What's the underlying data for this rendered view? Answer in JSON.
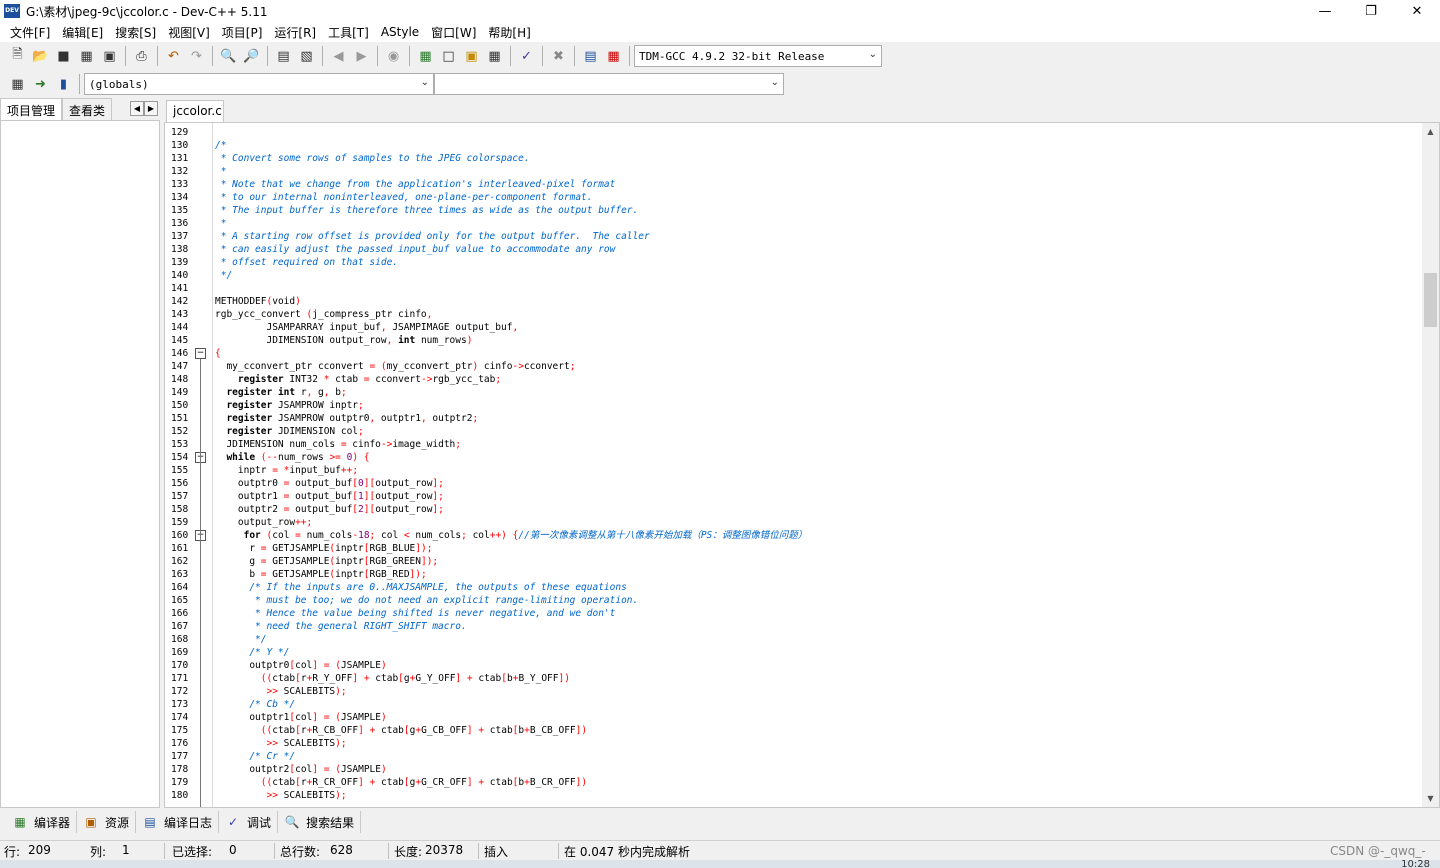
{
  "window": {
    "title": "G:\\素材\\jpeg-9c\\jccolor.c - Dev-C++ 5.11",
    "icon_text": "DEV"
  },
  "menu": [
    "文件[F]",
    "编辑[E]",
    "搜索[S]",
    "视图[V]",
    "项目[P]",
    "运行[R]",
    "工具[T]",
    "AStyle",
    "窗口[W]",
    "帮助[H]"
  ],
  "toolbar": {
    "compiler": "TDM-GCC 4.9.2 32-bit Release",
    "scope": "(globals)",
    "member": ""
  },
  "left_panel": {
    "tabs": [
      "项目管理",
      "查看类"
    ]
  },
  "editor": {
    "file_tab": "jccolor.c",
    "lines": [
      {
        "n": "129",
        "text": ""
      },
      {
        "n": "130",
        "text": "/*"
      },
      {
        "n": "131",
        "text": " * Convert some rows of samples to the JPEG colorspace."
      },
      {
        "n": "132",
        "text": " *"
      },
      {
        "n": "133",
        "text": " * Note that we change from the application's interleaved-pixel format"
      },
      {
        "n": "134",
        "text": " * to our internal noninterleaved, one-plane-per-component format."
      },
      {
        "n": "135",
        "text": " * The input buffer is therefore three times as wide as the output buffer."
      },
      {
        "n": "136",
        "text": " *"
      },
      {
        "n": "137",
        "text": " * A starting row offset is provided only for the output buffer.  The caller"
      },
      {
        "n": "138",
        "text": " * can easily adjust the passed input_buf value to accommodate any row"
      },
      {
        "n": "139",
        "text": " * offset required on that side."
      },
      {
        "n": "140",
        "text": " */"
      },
      {
        "n": "141",
        "text": ""
      },
      {
        "n": "142",
        "text": "METHODDEF(void)"
      },
      {
        "n": "143",
        "text": "rgb_ycc_convert (j_compress_ptr cinfo,"
      },
      {
        "n": "144",
        "text": "         JSAMPARRAY input_buf, JSAMPIMAGE output_buf,"
      },
      {
        "n": "145",
        "text": "         JDIMENSION output_row, int num_rows)"
      },
      {
        "n": "146",
        "text": "{"
      },
      {
        "n": "147",
        "text": "  my_cconvert_ptr cconvert = (my_cconvert_ptr) cinfo->cconvert;"
      },
      {
        "n": "148",
        "text": "    register INT32 * ctab = cconvert->rgb_ycc_tab;"
      },
      {
        "n": "149",
        "text": "  register int r, g, b;"
      },
      {
        "n": "150",
        "text": "  register JSAMPROW inptr;"
      },
      {
        "n": "151",
        "text": "  register JSAMPROW outptr0, outptr1, outptr2;"
      },
      {
        "n": "152",
        "text": "  register JDIMENSION col;"
      },
      {
        "n": "153",
        "text": "  JDIMENSION num_cols = cinfo->image_width;"
      },
      {
        "n": "154",
        "text": "  while (--num_rows >= 0) {"
      },
      {
        "n": "155",
        "text": "    inptr = *input_buf++;"
      },
      {
        "n": "156",
        "text": "    outptr0 = output_buf[0][output_row];"
      },
      {
        "n": "157",
        "text": "    outptr1 = output_buf[1][output_row];"
      },
      {
        "n": "158",
        "text": "    outptr2 = output_buf[2][output_row];"
      },
      {
        "n": "159",
        "text": "    output_row++;"
      },
      {
        "n": "160",
        "text": "     for (col = num_cols-18; col < num_cols; col++) {//第一次像素调整从第十八像素开始加载（PS：调整图像错位问题）"
      },
      {
        "n": "161",
        "text": "      r = GETJSAMPLE(inptr[RGB_BLUE]);"
      },
      {
        "n": "162",
        "text": "      g = GETJSAMPLE(inptr[RGB_GREEN]);"
      },
      {
        "n": "163",
        "text": "      b = GETJSAMPLE(inptr[RGB_RED]);"
      },
      {
        "n": "164",
        "text": "      /* If the inputs are 0..MAXJSAMPLE, the outputs of these equations"
      },
      {
        "n": "165",
        "text": "       * must be too; we do not need an explicit range-limiting operation."
      },
      {
        "n": "166",
        "text": "       * Hence the value being shifted is never negative, and we don't"
      },
      {
        "n": "167",
        "text": "       * need the general RIGHT_SHIFT macro."
      },
      {
        "n": "168",
        "text": "       */"
      },
      {
        "n": "169",
        "text": "      /* Y */"
      },
      {
        "n": "170",
        "text": "      outptr0[col] = (JSAMPLE)"
      },
      {
        "n": "171",
        "text": "        ((ctab[r+R_Y_OFF] + ctab[g+G_Y_OFF] + ctab[b+B_Y_OFF])"
      },
      {
        "n": "172",
        "text": "         >> SCALEBITS);"
      },
      {
        "n": "173",
        "text": "      /* Cb */"
      },
      {
        "n": "174",
        "text": "      outptr1[col] = (JSAMPLE)"
      },
      {
        "n": "175",
        "text": "        ((ctab[r+R_CB_OFF] + ctab[g+G_CB_OFF] + ctab[b+B_CB_OFF])"
      },
      {
        "n": "176",
        "text": "         >> SCALEBITS);"
      },
      {
        "n": "177",
        "text": "      /* Cr */"
      },
      {
        "n": "178",
        "text": "      outptr2[col] = (JSAMPLE)"
      },
      {
        "n": "179",
        "text": "        ((ctab[r+R_CR_OFF] + ctab[g+G_CR_OFF] + ctab[b+B_CR_OFF])"
      },
      {
        "n": "180",
        "text": "         >> SCALEBITS);"
      }
    ]
  },
  "bottom_tabs": [
    {
      "label": "编译器",
      "icon": "grid-icon"
    },
    {
      "label": "资源",
      "icon": "resources-icon"
    },
    {
      "label": "编译日志",
      "icon": "chart-icon"
    },
    {
      "label": "调试",
      "icon": "check-icon"
    },
    {
      "label": "搜索结果",
      "icon": "search-icon"
    }
  ],
  "status": {
    "row_label": "行:",
    "row_value": "209",
    "col_label": "列:",
    "col_value": "1",
    "sel_label": "已选择:",
    "sel_value": "0",
    "total_label": "总行数:",
    "total_value": "628",
    "len_label": "长度:",
    "len_value": "20378",
    "mode": "插入",
    "parse": "在 0.047 秒内完成解析"
  },
  "watermark": "CSDN @-_qwq_-",
  "taskbar_clock": "10:28",
  "colors": {
    "comment": "#0066cc",
    "operator": "#ff0000",
    "number": "#800080",
    "accent": "#1c4f9c"
  }
}
